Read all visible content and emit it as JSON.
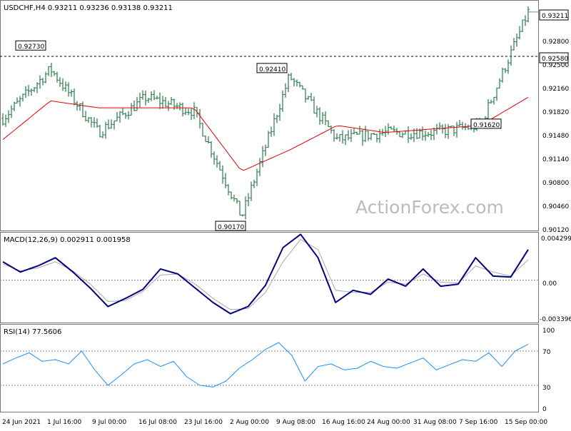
{
  "colors": {
    "background": "#ffffff",
    "bars": "#2b7a4b",
    "ma": "#e00000",
    "macd_line": "#000080",
    "macd_signal": "#a9a9a9",
    "rsi": "#1e90ff",
    "grid": "#888888"
  },
  "watermark": "ActionForex.com",
  "price_panel": {
    "header": "USDCHF,H4  0.93211  0.93236  0.93138  0.93211",
    "current_price_label": "0.93211",
    "level_line_label": "0.92580",
    "callouts": [
      "0.92730",
      "0.92410",
      "0.90170",
      "0.91620"
    ]
  },
  "macd_panel": {
    "header": "MACD(12,26,9)  0.002911  0.001958",
    "axis_labels": [
      "0.004299",
      "0.00",
      "-0.003396"
    ]
  },
  "rsi_panel": {
    "header": "RSI(14)  77.5606",
    "axis_labels": [
      "100",
      "70",
      "30",
      "0"
    ]
  },
  "x_axis_labels": [
    "24 Jun 2021",
    "1 Jul 16:00",
    "9 Jul 00:00",
    "16 Jul 08:00",
    "23 Jul 16:00",
    "2 Aug 00:00",
    "9 Aug 08:00",
    "16 Aug 16:00",
    "24 Aug 00:00",
    "31 Aug 08:00",
    "7 Sep 16:00",
    "15 Sep 00:00"
  ],
  "chart_data": [
    {
      "type": "line",
      "chart_subtype": "ohlc-bars",
      "title": "USDCHF,H4",
      "ylim": [
        0.9012,
        0.9336
      ],
      "y_ticks": [
        "0.92800",
        "0.92500",
        "0.92160",
        "0.91820",
        "0.91480",
        "0.91140",
        "0.90800",
        "0.90460",
        "0.90120"
      ],
      "dashed_level": 0.9258,
      "annotations": [
        {
          "label": "0.92730",
          "value": 0.9273
        },
        {
          "label": "0.92410",
          "value": 0.9241
        },
        {
          "label": "0.90170",
          "value": 0.9017
        },
        {
          "label": "0.91620",
          "value": 0.9162
        }
      ],
      "series": [
        {
          "name": "USDCHF close (approx.)",
          "x": [
            "24 Jun 2021",
            "1 Jul 16:00",
            "9 Jul 00:00",
            "16 Jul 08:00",
            "23 Jul 16:00",
            "2 Aug 00:00",
            "9 Aug 08:00",
            "16 Aug 16:00",
            "24 Aug 00:00",
            "31 Aug 08:00",
            "7 Sep 16:00",
            "15 Sep 00:00"
          ],
          "values": [
            0.917,
            0.924,
            0.915,
            0.92,
            0.918,
            0.903,
            0.923,
            0.914,
            0.915,
            0.915,
            0.916,
            0.9321
          ]
        },
        {
          "name": "moving average (approx.)",
          "x": [
            "24 Jun 2021",
            "1 Jul 16:00",
            "9 Jul 00:00",
            "16 Jul 08:00",
            "23 Jul 16:00",
            "2 Aug 00:00",
            "9 Aug 08:00",
            "16 Aug 16:00",
            "24 Aug 00:00",
            "31 Aug 08:00",
            "7 Sep 16:00",
            "15 Sep 00:00"
          ],
          "values": [
            0.914,
            0.9195,
            0.9185,
            0.9185,
            0.9185,
            0.9095,
            0.9125,
            0.916,
            0.915,
            0.9155,
            0.916,
            0.92
          ]
        }
      ]
    },
    {
      "type": "line",
      "title": "MACD(12,26,9)",
      "ylim": [
        -0.0041,
        0.0046
      ],
      "y_ticks": [
        0.004299,
        0.0,
        -0.003396
      ],
      "series": [
        {
          "name": "MACD",
          "values": [
            0.0018,
            0.0008,
            0.0014,
            0.0022,
            0.0008,
            -0.0008,
            -0.0026,
            -0.0018,
            -0.0009,
            0.0011,
            0.0006,
            -0.0008,
            -0.0022,
            -0.0033,
            -0.0026,
            -0.0005,
            0.0032,
            0.0045,
            0.0022,
            -0.0022,
            -0.001,
            -0.0014,
            0.0001,
            -0.0006,
            0.0011,
            -0.0006,
            -0.0004,
            0.0022,
            0.0004,
            0.0003,
            0.003
          ]
        },
        {
          "name": "signal",
          "values": [
            0.0016,
            0.0009,
            0.0012,
            0.0018,
            0.0009,
            -0.0004,
            -0.0021,
            -0.002,
            -0.0011,
            0.0005,
            0.0006,
            -0.0004,
            -0.0018,
            -0.0029,
            -0.0028,
            -0.0012,
            0.0018,
            0.004,
            0.003,
            -0.001,
            -0.0012,
            -0.0012,
            -0.0002,
            -0.0004,
            0.0006,
            -0.0002,
            -0.0003,
            0.0014,
            0.0008,
            0.0004,
            0.002
          ]
        }
      ]
    },
    {
      "type": "line",
      "title": "RSI(14)",
      "ylim": [
        0,
        100
      ],
      "y_ticks": [
        100,
        70,
        30,
        0
      ],
      "levels": [
        70,
        30
      ],
      "series": [
        {
          "name": "RSI(14)",
          "values": [
            55,
            62,
            68,
            58,
            60,
            55,
            70,
            48,
            30,
            42,
            55,
            60,
            52,
            58,
            40,
            30,
            28,
            35,
            50,
            60,
            72,
            80,
            65,
            35,
            52,
            55,
            48,
            50,
            58,
            52,
            50,
            56,
            62,
            48,
            54,
            60,
            58,
            68,
            52,
            70,
            78
          ]
        }
      ]
    }
  ]
}
